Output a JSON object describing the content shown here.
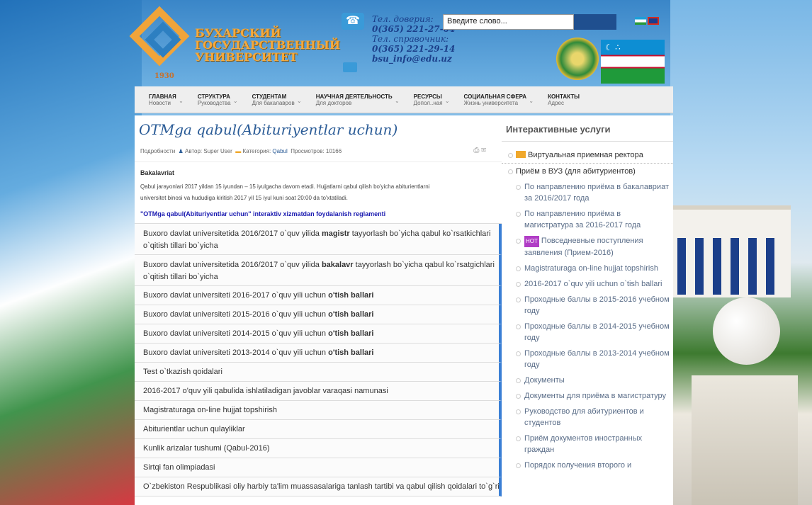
{
  "header": {
    "logo_year": "1930",
    "university_lines": [
      "БУХАРСКИЙ",
      "ГОСУДАРСТВЕННЫЙ",
      "УНИВЕРСИТЕТ"
    ],
    "phone_label_1": "Тел. доверия:",
    "phone_1": "0(365) 221-27-64",
    "phone_label_2": "Тел. справочник:",
    "phone_2": "0(365) 221-29-14",
    "email": "bsu_info@edu.uz",
    "search_placeholder": "Введите слово..."
  },
  "nav": [
    {
      "title": "ГЛАВНАЯ",
      "sub": "Новости"
    },
    {
      "title": "СТРУКТУРА",
      "sub": "Руководства"
    },
    {
      "title": "СТУДЕНТАМ",
      "sub": "Для бакалавров"
    },
    {
      "title": "НАУЧНАЯ ДЕЯТЕЛЬНОСТЬ",
      "sub": "Для докторов"
    },
    {
      "title": "РЕСУРСЫ",
      "sub": "Допол..ная"
    },
    {
      "title": "СОЦИАЛЬНАЯ СФЕРА",
      "sub": "Жизнь университета"
    },
    {
      "title": "КОНТАКТЫ",
      "sub": "Адрес"
    }
  ],
  "article": {
    "title": "OTMga qabul(Abituriyentlar uchun)",
    "meta_details": "Подробности",
    "meta_author": "Автор: Super User",
    "meta_category_label": "Категория:",
    "meta_category": "Qabul",
    "meta_views": "Просмотров: 10166",
    "section": "Bakalavriat",
    "body_1": "Qabul jarayonlari 2017 yildan 15 iyundan – 15 iyulgacha davom etadi. Hujjatlarni qabul qilish bo'yicha abiturientlarni",
    "body_2": "universitet binosi va hududiga kiritish 2017 yil 15 iyul kuni soat 20:00 da to'xtatiladi.",
    "regulation": "\"OTMga qabul(Abituriyentlar uchun\" interaktiv xizmatdan foydalanish reglamenti"
  },
  "links": [
    {
      "pre": "Buxoro davlat universitetida 2016/2017 o`quv yilida ",
      "bold": "magistr",
      "post": " tayyorlash bo`yicha qabul ko`rsatkichlari",
      "line2": "o`qitish tillari bo`yicha"
    },
    {
      "pre": "Buxoro davlat universitetida 2016/2017 o`quv yilida ",
      "bold": "bakalavr",
      "post": " tayyorlash bo`yicha qabul ko`rsatgichlari",
      "line2": "o`qitish tillari bo`yicha"
    },
    {
      "pre": "Buxoro davlat universiteti 2016-2017 o`quv yili uchun ",
      "bold": "o'tish ballari",
      "post": "",
      "line2": ""
    },
    {
      "pre": "Buxoro davlat universiteti 2015-2016 o`quv yili uchun ",
      "bold": "o'tish ballari",
      "post": "",
      "line2": ""
    },
    {
      "pre": "Buxoro davlat universiteti 2014-2015 o`quv yili uchun ",
      "bold": "o'tish ballari",
      "post": "",
      "line2": ""
    },
    {
      "pre": "Buxoro davlat universiteti 2013-2014 o`quv yili uchun ",
      "bold": "o'tish ballari",
      "post": "",
      "line2": ""
    },
    {
      "pre": "Test o`tkazish qoidalari",
      "bold": "",
      "post": "",
      "line2": ""
    },
    {
      "pre": "2016-2017 o'quv yili qabulida ishlatiladigan javoblar varaqasi namunasi",
      "bold": "",
      "post": "",
      "line2": ""
    },
    {
      "pre": "Magistraturaga on-line hujjat topshirish",
      "bold": "",
      "post": "",
      "line2": ""
    },
    {
      "pre": "Abiturientlar uchun qulayliklar",
      "bold": "",
      "post": "",
      "line2": ""
    },
    {
      "pre": "Kunlik arizalar tushumi (Qabul-2016)",
      "bold": "",
      "post": "",
      "line2": ""
    },
    {
      "pre": "Sirtqi fan olimpiadasi",
      "bold": "",
      "post": "",
      "line2": ""
    },
    {
      "pre": "O`zbekiston Respublikasi oliy harbiy ta'lim muassasalariga tanlash tartibi va qabul qilish qoidalari to`g`risida",
      "bold": "",
      "post": "",
      "line2": ""
    }
  ],
  "sidebar": {
    "title": "Интерактивные услуги",
    "top_items": [
      "Виртуальная  приемная ректора",
      "Приём в ВУЗ (для абитуриентов)"
    ],
    "hot_badge": "HOT",
    "sub_items": [
      "По направлению приёма в бакалавриат за 2016/2017 года",
      "По направлению приёма в магистратура за 2016-2017 года",
      "Повседневные поступления заявления (Прием-2016)",
      "Magistraturaga on-line hujjat topshirish",
      "2016-2017 o`quv yili uchun o`tish ballari",
      "Проходные баллы в 2015-2016 учебном году",
      "Проходные баллы в 2014-2015 учебном году",
      "Проходные баллы в 2013-2014 учебном году",
      "Документы",
      "Документы для приёма в магистратуру",
      "Руководство для абитуриентов и студентов",
      "Приём документов иностранных граждан",
      "Порядок получения второго и"
    ]
  }
}
